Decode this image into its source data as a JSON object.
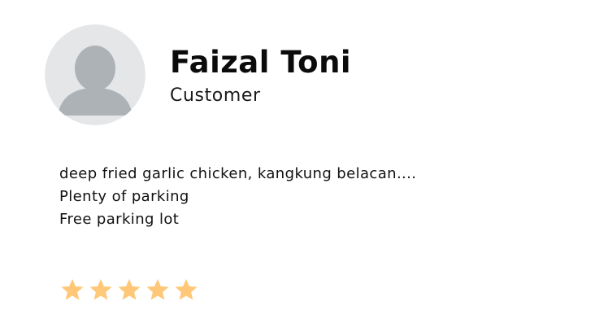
{
  "reviewer": {
    "name": "Faizal Toni",
    "role": "Customer",
    "avatar_icon": "default-user-avatar-icon"
  },
  "review": {
    "lines": [
      "deep fried garlic chicken, kangkung belacan....",
      "Plenty of parking",
      "Free parking lot"
    ]
  },
  "rating": {
    "value": 5,
    "max": 5,
    "star_icon": "star-icon",
    "star_color": "#FFC878"
  },
  "colors": {
    "avatar_background": "#E4E6E8",
    "avatar_silhouette": "#ADB2B7"
  }
}
